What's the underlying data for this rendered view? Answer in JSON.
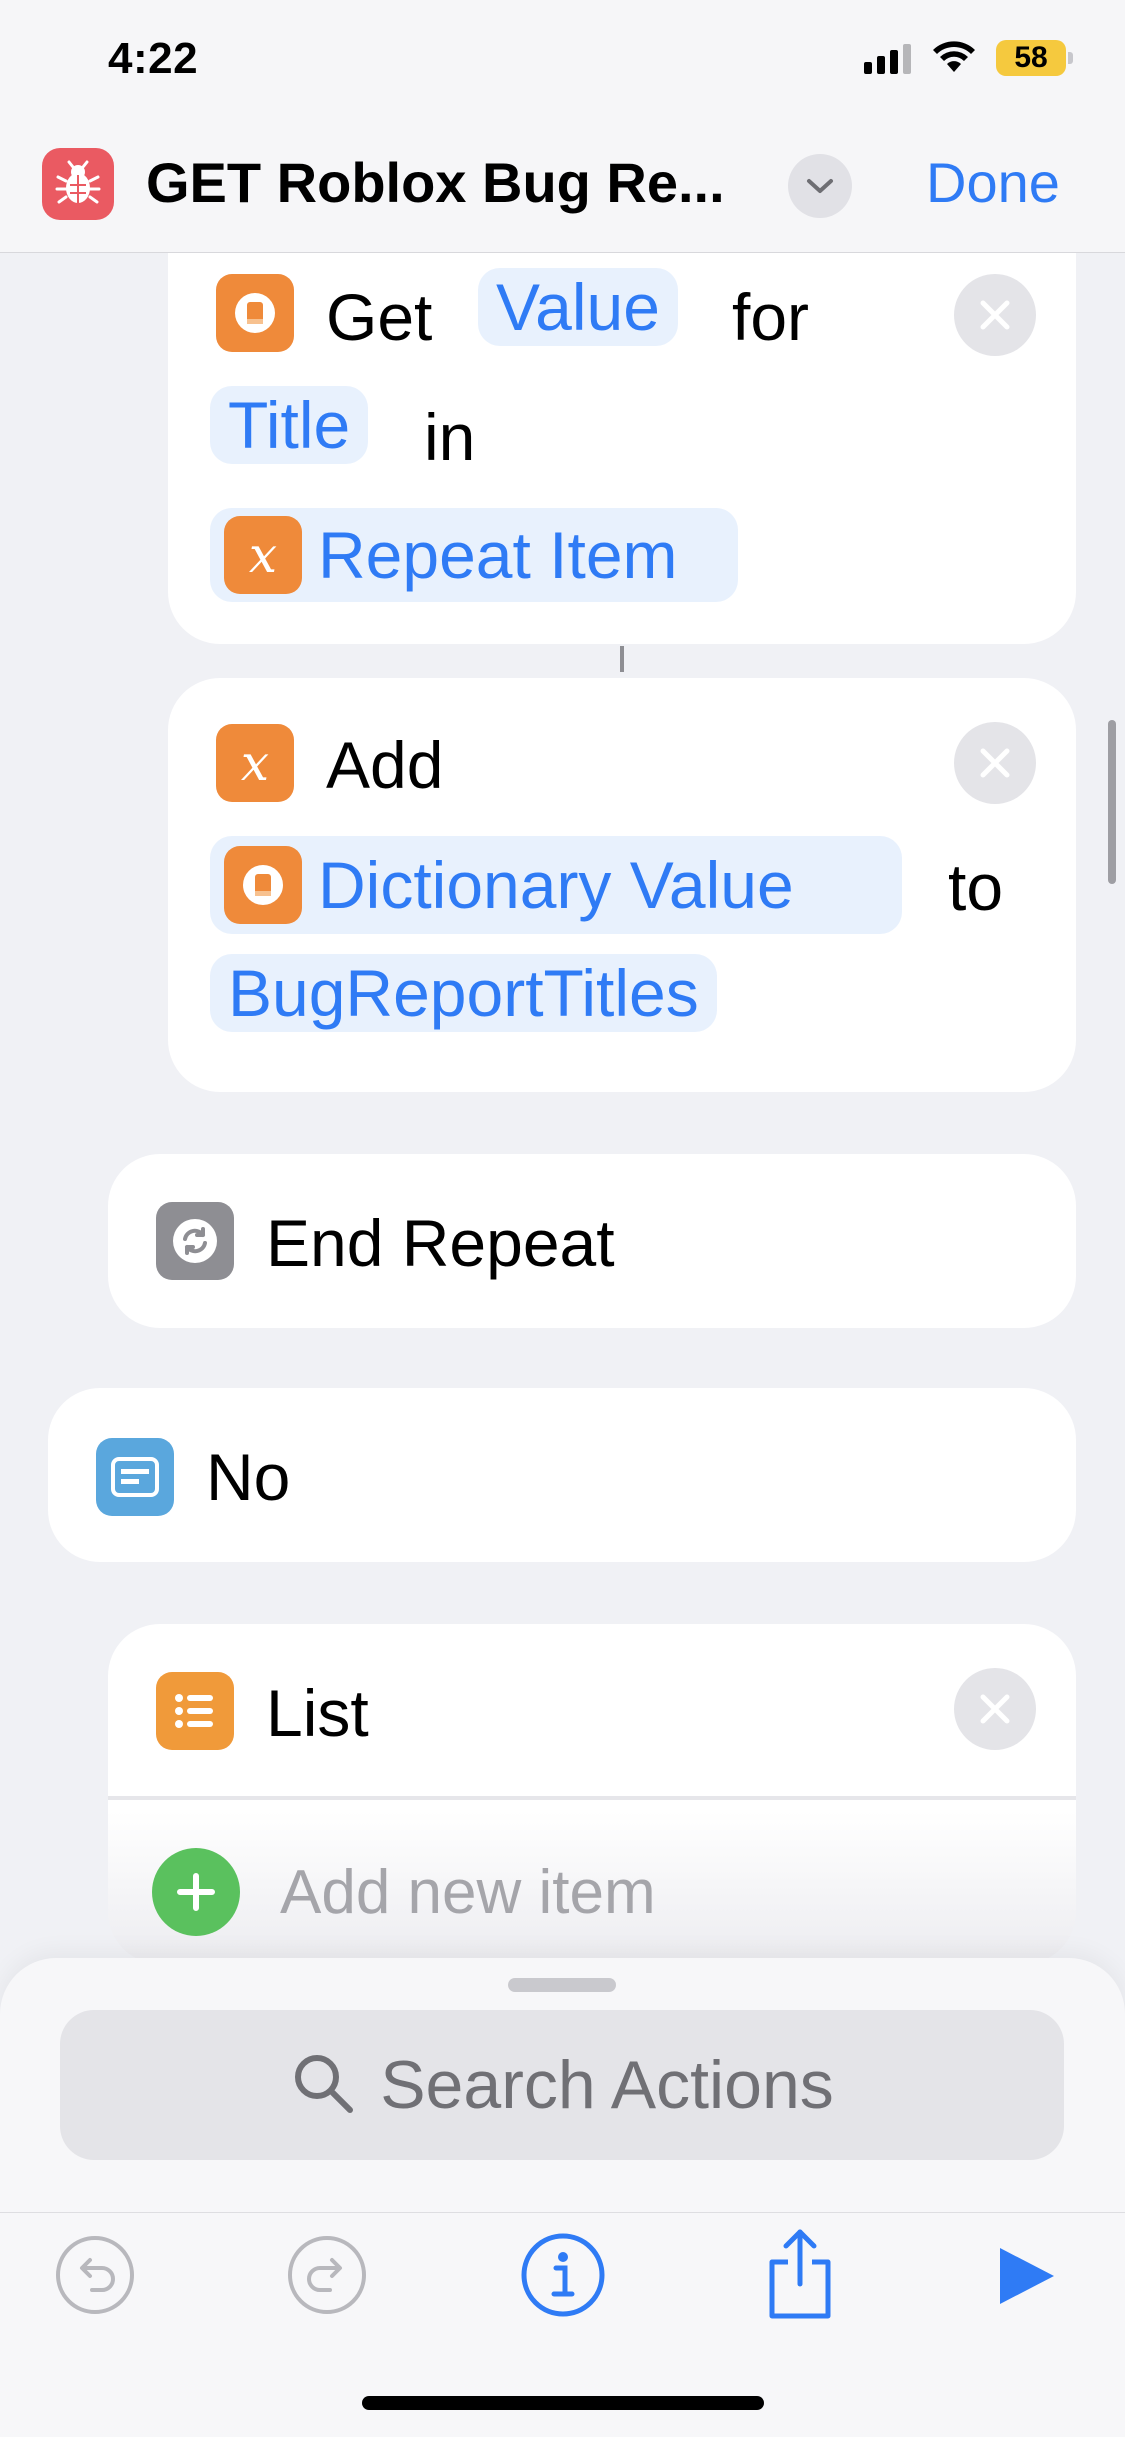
{
  "status_bar": {
    "time": "4:22",
    "battery": "58"
  },
  "nav": {
    "title": "GET Roblox Bug Re...",
    "done_label": "Done"
  },
  "get_value_action": {
    "verb": "Get",
    "value_token": "Value",
    "for_label": "for",
    "key_token": "Title",
    "in_label": "in",
    "source_token": "Repeat Item"
  },
  "add_action": {
    "verb": "Add",
    "value_token": "Dictionary Value",
    "to_label": "to",
    "variable_token": "BugReportTitles"
  },
  "end_repeat": {
    "label": "End Repeat"
  },
  "no_block": {
    "label": "No"
  },
  "list_action": {
    "label": "List",
    "add_item_placeholder": "Add new item"
  },
  "search": {
    "placeholder": "Search Actions"
  },
  "colors": {
    "accent": "#2f7bf5",
    "variable_orange": "#ef8a3a",
    "add_green": "#5ac15e"
  },
  "icons": [
    "bug-icon",
    "chevron-down-icon",
    "dictionary-icon",
    "variable-x-icon",
    "repeat-icon",
    "menu-icon",
    "list-icon",
    "close-icon",
    "plus-icon",
    "search-icon",
    "undo-icon",
    "redo-icon",
    "info-icon",
    "share-icon",
    "play-icon"
  ]
}
